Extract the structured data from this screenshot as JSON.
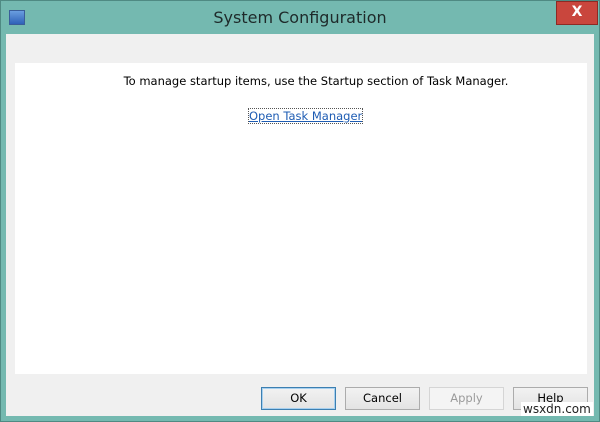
{
  "window": {
    "title": "System Configuration",
    "close_label": "X"
  },
  "content": {
    "message": "To manage startup items, use the Startup section of Task Manager.",
    "link": "Open Task Manager"
  },
  "buttons": {
    "ok": "OK",
    "cancel": "Cancel",
    "apply": "Apply",
    "help": "Help"
  },
  "watermark": "wsxdn.com"
}
